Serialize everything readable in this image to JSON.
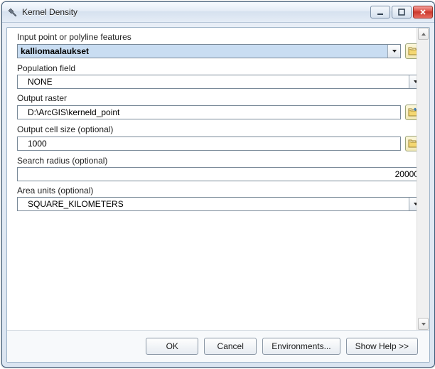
{
  "titlebar": {
    "title": "Kernel Density"
  },
  "fields": {
    "input_features": {
      "label": "Input point or polyline features",
      "value": "kalliomaalaukset"
    },
    "population_field": {
      "label": "Population field",
      "value": "NONE"
    },
    "output_raster": {
      "label": "Output raster",
      "value": "D:\\ArcGIS\\kerneld_point"
    },
    "output_cell_size": {
      "label": "Output cell size (optional)",
      "value": "1000"
    },
    "search_radius": {
      "label": "Search radius (optional)",
      "value": "20000"
    },
    "area_units": {
      "label": "Area units (optional)",
      "value": "SQUARE_KILOMETERS"
    }
  },
  "buttons": {
    "ok": "OK",
    "cancel": "Cancel",
    "environments": "Environments...",
    "show_help": "Show Help >>"
  },
  "icons": {
    "hammer": "hammer-icon",
    "minimize": "minimize-icon",
    "maximize": "maximize-icon",
    "close": "close-icon",
    "dropdown": "chevron-down-icon",
    "browse": "folder-open-icon",
    "browse_add": "folder-add-icon",
    "scroll_up": "scroll-up-icon",
    "scroll_down": "scroll-down-icon"
  }
}
